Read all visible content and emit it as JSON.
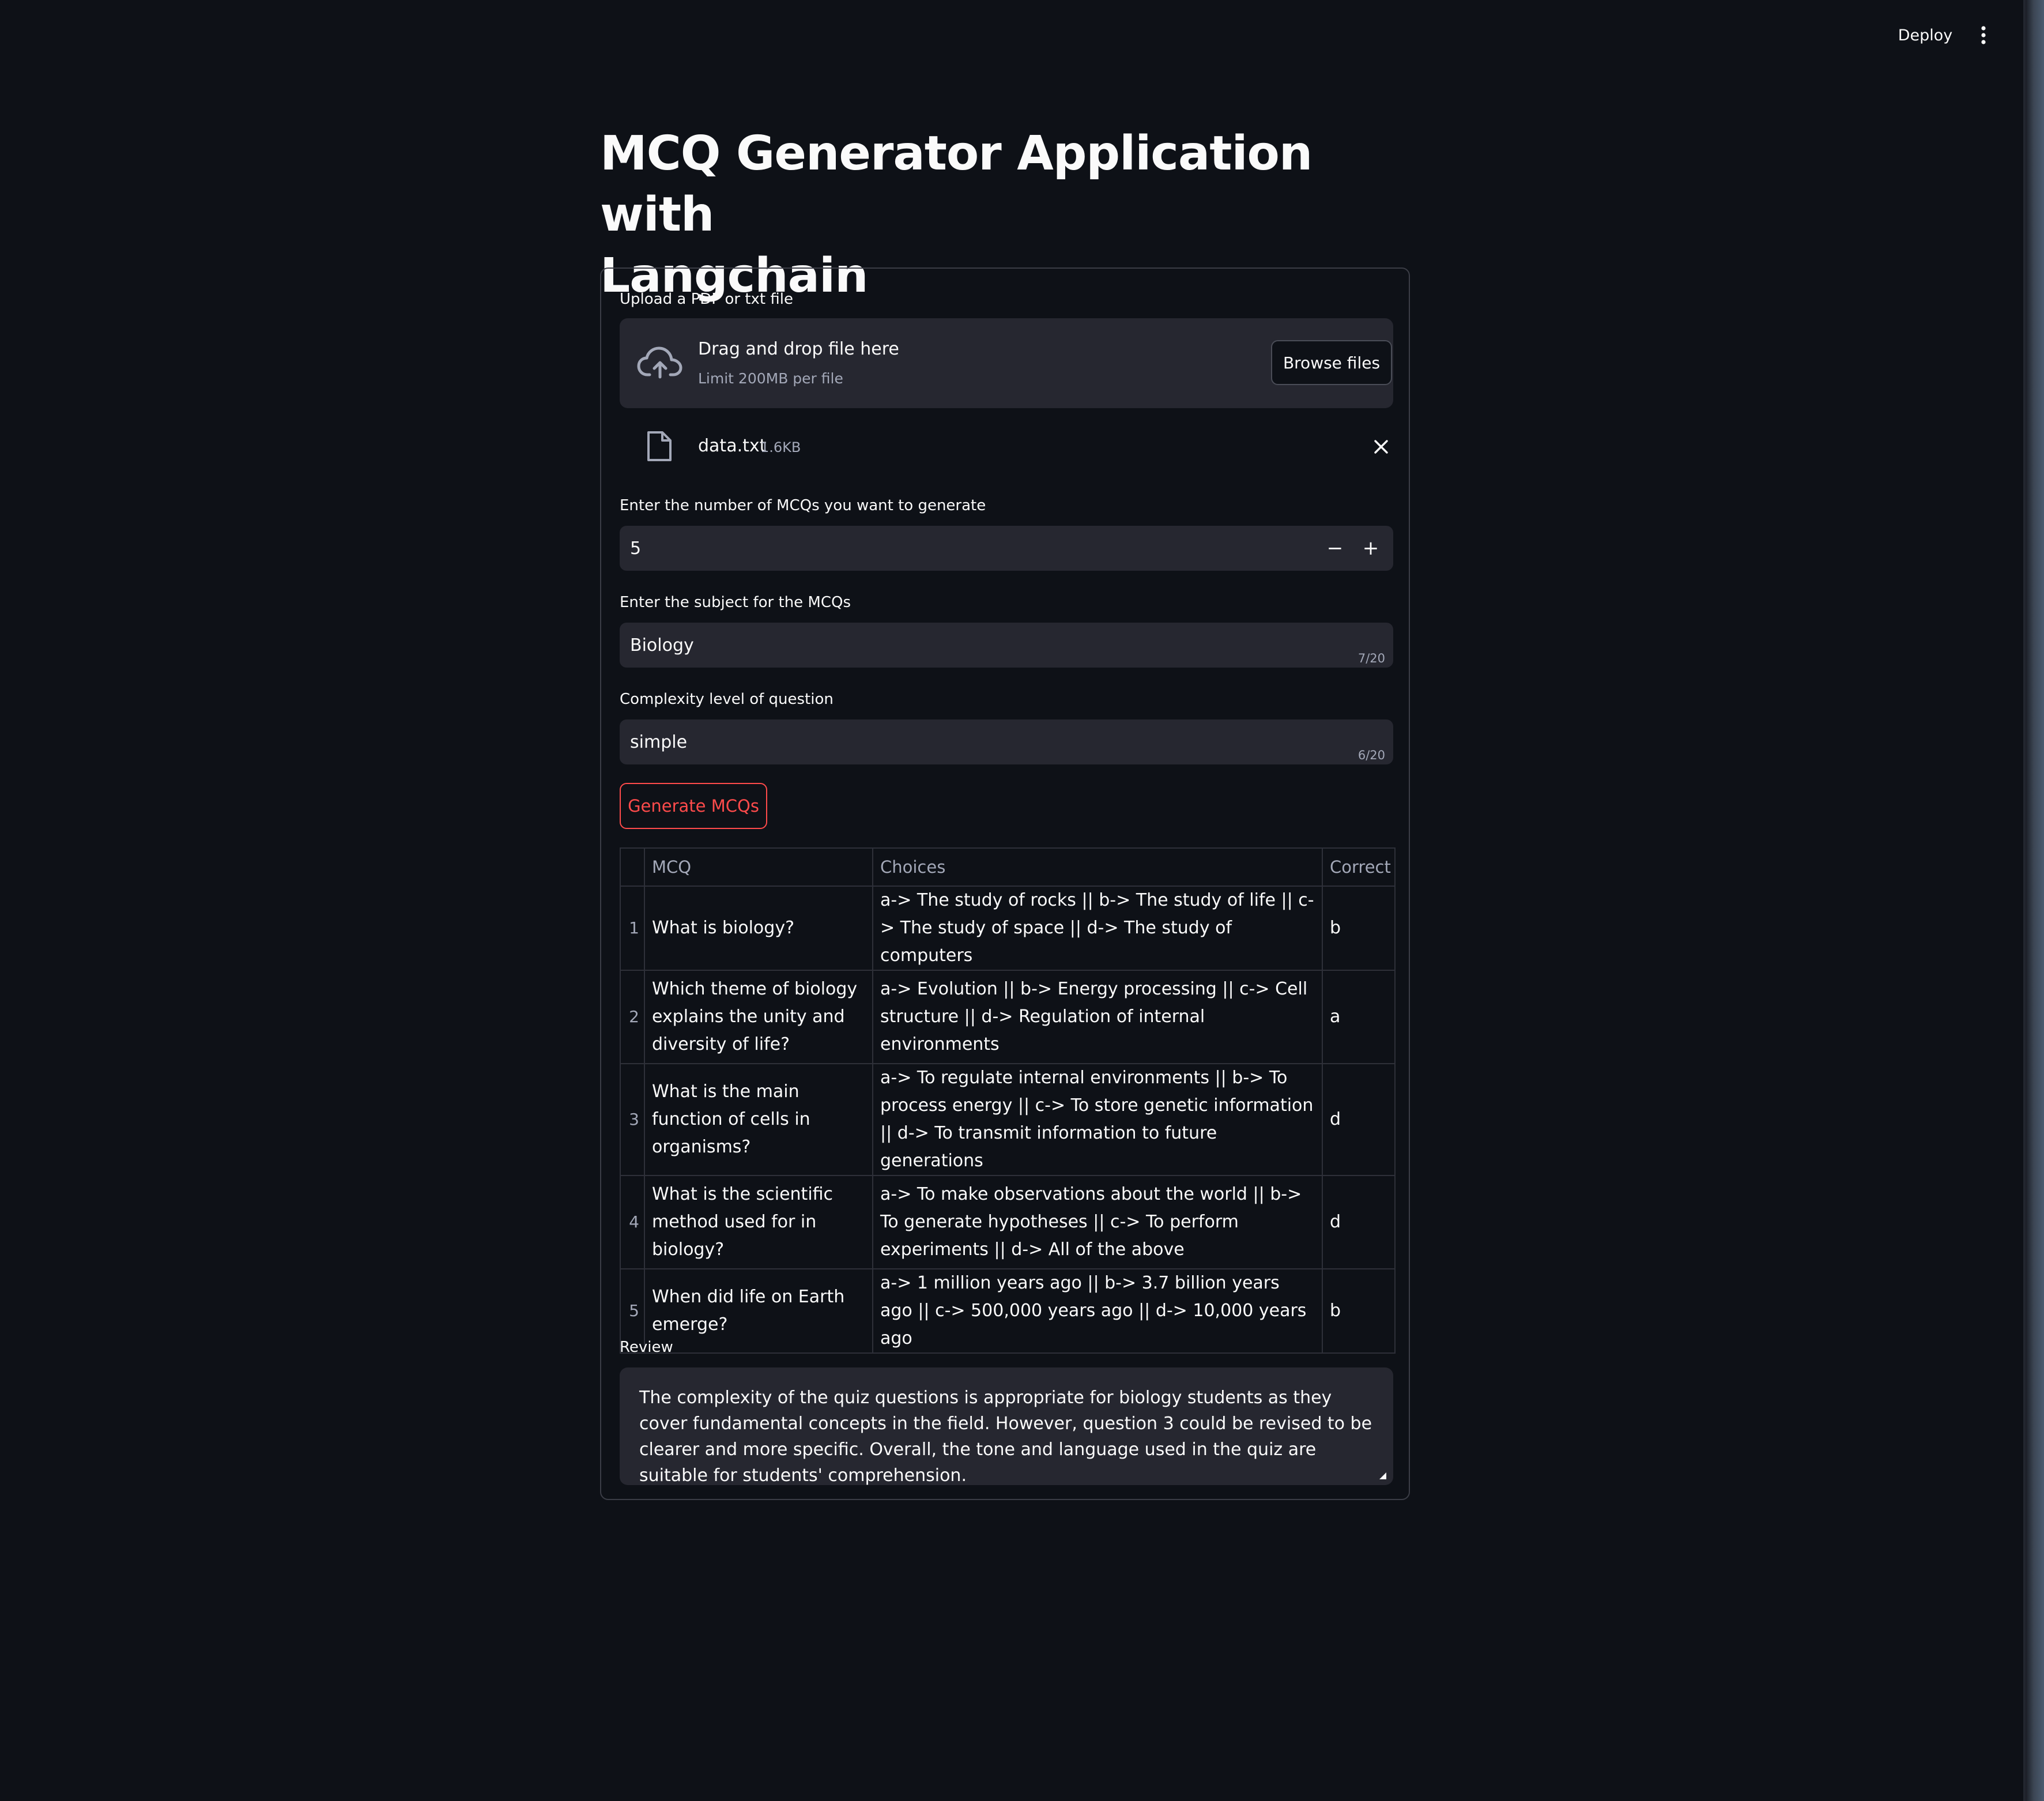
{
  "toolbar": {
    "deploy_label": "Deploy",
    "menu_icon": "vertical-dots-icon"
  },
  "page": {
    "title_line1": "MCQ Generator Application with",
    "title_line2": "Langchain"
  },
  "uploader": {
    "label": "Upload a PDF or txt file",
    "drop_title": "Drag and drop file here",
    "drop_subtitle": "Limit 200MB per file",
    "browse_label": "Browse files",
    "icon": "cloud-upload-icon",
    "file": {
      "name": "data.txt",
      "size": "1.6KB",
      "icon": "file-icon",
      "remove_icon": "close-icon"
    }
  },
  "mcq_count": {
    "label": "Enter the number of MCQs you want to generate",
    "value": "5",
    "decrement": "−",
    "increment": "+"
  },
  "subject": {
    "label": "Enter the subject for the MCQs",
    "value": "Biology",
    "counter": "7/20"
  },
  "complexity": {
    "label": "Complexity level of question",
    "value": "simple",
    "counter": "6/20"
  },
  "generate_label": "Generate MCQs",
  "table": {
    "headers": [
      "",
      "MCQ",
      "Choices",
      "Correct"
    ],
    "rows": [
      {
        "index": "1",
        "mcq": "What is biology?",
        "choices": "a-> The study of rocks || b-> The study of life || c-> The study of space || d-> The study of computers",
        "correct": "b"
      },
      {
        "index": "2",
        "mcq": "Which theme of biology explains the unity and diversity of life?",
        "choices": "a-> Evolution || b-> Energy processing || c-> Cell structure || d-> Regulation of internal environments",
        "correct": "a"
      },
      {
        "index": "3",
        "mcq": "What is the main function of cells in organisms?",
        "choices": "a-> To regulate internal environments || b-> To process energy || c-> To store genetic information || d-> To transmit information to future generations",
        "correct": "d"
      },
      {
        "index": "4",
        "mcq": "What is the scientific method used for in biology?",
        "choices": "a-> To make observations about the world || b-> To generate hypotheses || c-> To perform experiments || d-> All of the above",
        "correct": "d"
      },
      {
        "index": "5",
        "mcq": "When did life on Earth emerge?",
        "choices": "a-> 1 million years ago || b-> 3.7 billion years ago || c-> 500,000 years ago || d-> 10,000 years ago",
        "correct": "b"
      }
    ]
  },
  "review": {
    "label": "Review",
    "text": "The complexity of the quiz questions is appropriate for biology students as they cover fundamental concepts in the field. However, question 3 could be revised to be clearer and more specific. Overall, the tone and language used in the quiz are suitable for students' comprehension."
  },
  "colors": {
    "background": "#0e1117",
    "surface": "#262730",
    "border": "#3b3d46",
    "accent": "#ff4b4b",
    "muted_text": "#a3a8b8"
  }
}
